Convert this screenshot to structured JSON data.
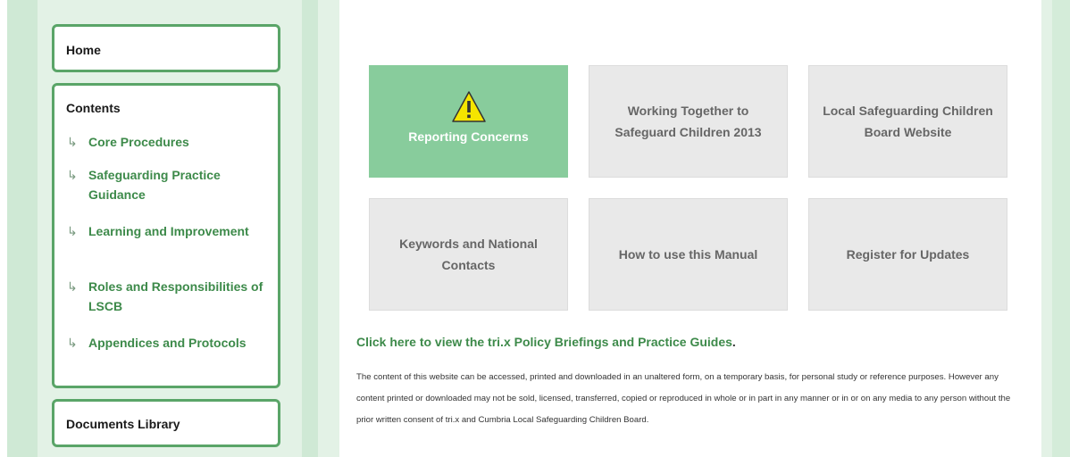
{
  "colors": {
    "accent_green": "#5aa568",
    "link_green": "#3d8a4a",
    "featured_tile": "#88cc9c",
    "tile_gray": "#e9e9e9",
    "warning_yellow": "#f5e500"
  },
  "sidebar": {
    "home": {
      "label": "Home"
    },
    "contents": {
      "title": "Contents",
      "arrow": "↳",
      "items": [
        {
          "label": "Core Procedures"
        },
        {
          "label": "Safeguarding Practice Guidance"
        },
        {
          "label": "Learning and Improvement"
        },
        {
          "label": "Roles and Responsibilities of LSCB"
        },
        {
          "label": "Appendices and Protocols"
        }
      ]
    },
    "documents": {
      "label": "Documents Library"
    }
  },
  "tiles": [
    {
      "label": "Reporting Concerns",
      "icon": "warning-icon"
    },
    {
      "label": "Working Together to Safeguard Children 2013"
    },
    {
      "label": "Local Safeguarding Children Board Website"
    },
    {
      "label": "Keywords and National Contacts"
    },
    {
      "label": "How to use this Manual"
    },
    {
      "label": "Register for Updates"
    }
  ],
  "policy_link": {
    "text": "Click here to view the tri.x Policy Briefings and Practice Guides",
    "suffix": "."
  },
  "disclaimer": "The content of this website can be accessed, printed and downloaded in an unaltered form, on a temporary basis, for personal study or reference purposes. However any content printed or downloaded may not be sold, licensed, transferred, copied or reproduced in whole or in part in any manner or in or on any media to any person without the prior written consent of tri.x and Cumbria Local Safeguarding Children Board."
}
